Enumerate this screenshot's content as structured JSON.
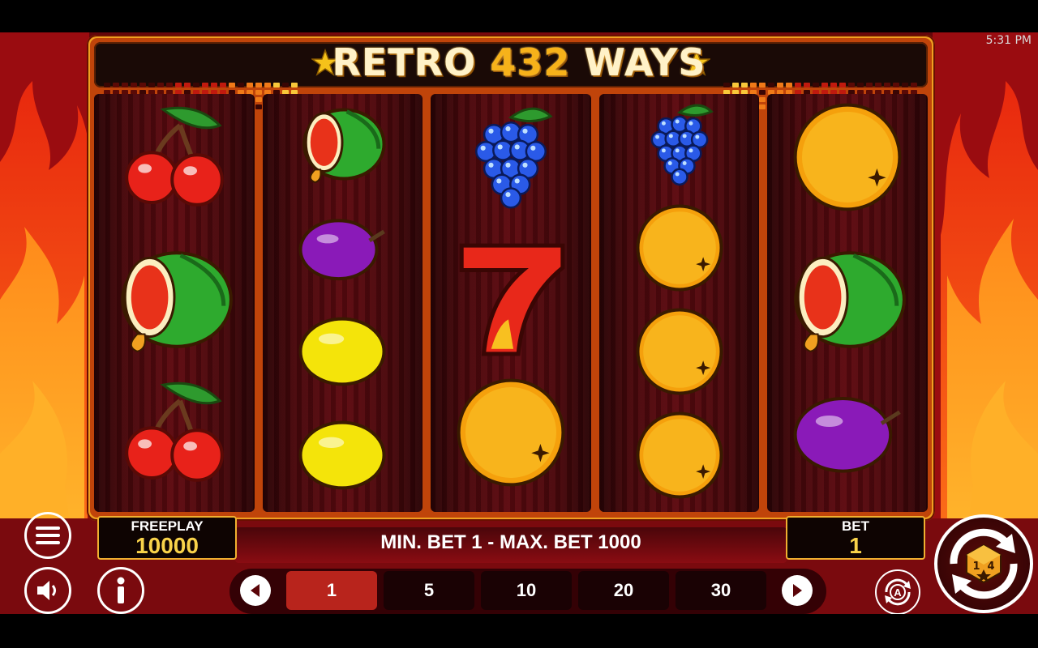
{
  "status": {
    "time": "5:31 PM"
  },
  "title": {
    "prefix": "RETRO",
    "number": "432",
    "suffix": "WAYS"
  },
  "reels": [
    [
      "cherries",
      "watermelon",
      "cherries"
    ],
    [
      "watermelon",
      "plum",
      "lemon",
      "lemon"
    ],
    [
      "grapes",
      "seven",
      "orange"
    ],
    [
      "grapes",
      "orange",
      "orange",
      "orange"
    ],
    [
      "orange",
      "watermelon",
      "plum"
    ]
  ],
  "freeplay": {
    "label": "FREEPLAY",
    "value": "10000"
  },
  "limits": "MIN. BET 1 - MAX. BET 1000",
  "bet": {
    "label": "BET",
    "value": "1"
  },
  "bet_options": [
    "1",
    "5",
    "10",
    "20",
    "30"
  ],
  "selected_bet": "1",
  "icons": {
    "menu": "hamburger-menu-icon",
    "sound": "speaker-icon",
    "info": "info-icon",
    "prev": "chevron-left-icon",
    "next": "chevron-right-icon",
    "autoplay": "autoplay-a-icon",
    "spin": "spin-arrows-icon"
  },
  "logo_text": "1x2"
}
